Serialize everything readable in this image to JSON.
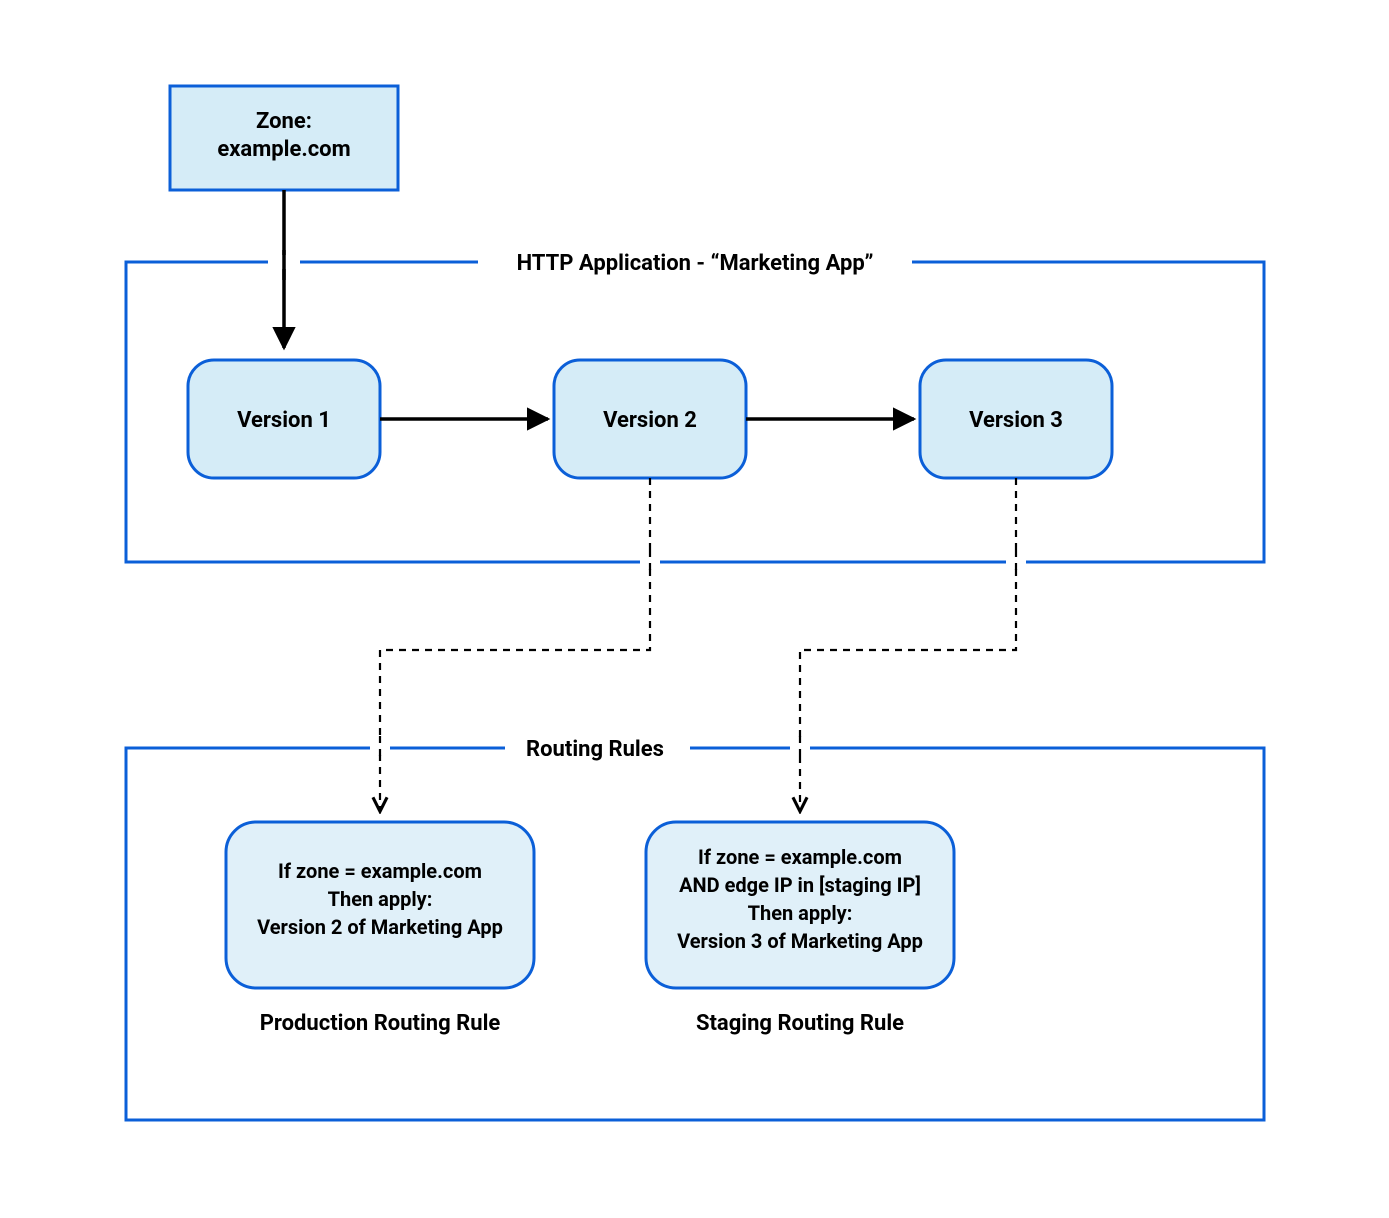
{
  "zone": {
    "label1": "Zone:",
    "label2": "example.com"
  },
  "app_frame": {
    "title": "HTTP Application - “Marketing App”"
  },
  "versions": {
    "v1": "Version 1",
    "v2": "Version 2",
    "v3": "Version 3"
  },
  "rules_frame": {
    "title": "Routing Rules"
  },
  "prod_rule": {
    "l1": "If zone = example.com",
    "l2": "Then apply:",
    "l3": "Version 2 of Marketing App",
    "caption": "Production Routing Rule"
  },
  "stage_rule": {
    "l1": "If zone = example.com",
    "l2": "AND edge IP in [staging IP]",
    "l3": "Then apply:",
    "l4": "Version 3 of Marketing App",
    "caption": "Staging Routing Rule"
  },
  "colors": {
    "stroke": "#0b5fd8",
    "fill_light": "#d5ecf7",
    "fill_rule": "#e0f0f9"
  }
}
